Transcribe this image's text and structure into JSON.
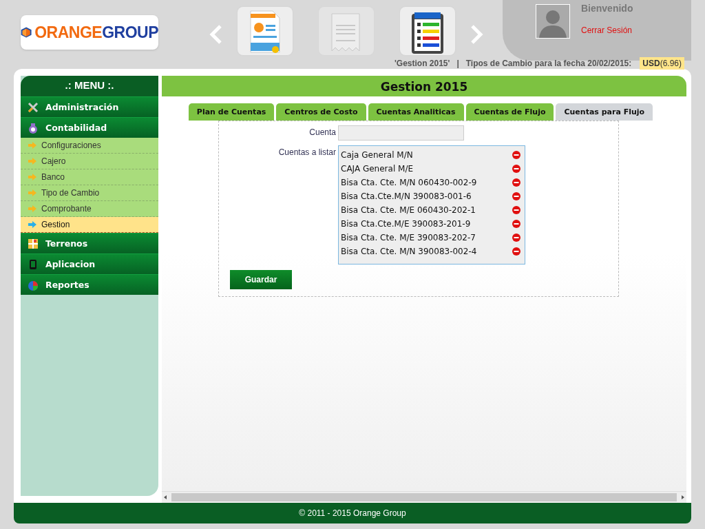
{
  "header": {
    "logo": {
      "brand_1": "ORANGE",
      "brand_2": "GROUP"
    },
    "tiles": [
      {
        "kind": "paycard",
        "disabled": false
      },
      {
        "kind": "receipt",
        "disabled": true
      },
      {
        "kind": "reserva",
        "disabled": false
      }
    ],
    "user": {
      "greeting": "Bienvenido",
      "logout": "Cerrar Sesión"
    },
    "info": {
      "gestion": "'Gestion 2015'",
      "separator": "|",
      "exchange_label": "Tipos de Cambio para la fecha 20/02/2015:",
      "currency": "USD",
      "rate": "(6.96)"
    }
  },
  "sidebar": {
    "title": ".: MENU :.",
    "items": [
      {
        "label": "Administración"
      },
      {
        "label": "Contabilidad",
        "children": [
          {
            "label": "Configuraciones",
            "selected": false
          },
          {
            "label": "Cajero",
            "selected": false
          },
          {
            "label": "Banco",
            "selected": false
          },
          {
            "label": "Tipo de Cambio",
            "selected": false
          },
          {
            "label": "Comprobante",
            "selected": false
          },
          {
            "label": "Gestion",
            "selected": true
          }
        ]
      },
      {
        "label": "Terrenos"
      },
      {
        "label": "Aplicacion"
      },
      {
        "label": "Reportes"
      }
    ]
  },
  "content": {
    "title": "Gestion 2015",
    "tabs": [
      {
        "label": "Plan de Cuentas",
        "selected": false
      },
      {
        "label": "Centros de Costo",
        "selected": false
      },
      {
        "label": "Cuentas Analiticas",
        "selected": false
      },
      {
        "label": "Cuentas de Flujo",
        "selected": false
      },
      {
        "label": "Cuentas para Flujo",
        "selected": true
      }
    ],
    "form": {
      "cuenta_label": "Cuenta",
      "list_label": "Cuentas a listar",
      "accounts": [
        "Caja General M/N",
        "CAJA General M/E",
        "Bisa Cta. Cte. M/N 060430-002-9",
        "Bisa Cta.Cte.M/N 390083-001-6",
        "Bisa Cta. Cte. M/E 060430-202-1",
        "Bisa Cta.Cte.M/E 390083-201-9",
        "Bisa Cta. Cte. M/E 390083-202-7",
        "Bisa Cta. Cte. M/N 390083-002-4"
      ],
      "save_button": "Guardar"
    }
  },
  "footer": "© 2011 - 2015 Orange Group"
}
